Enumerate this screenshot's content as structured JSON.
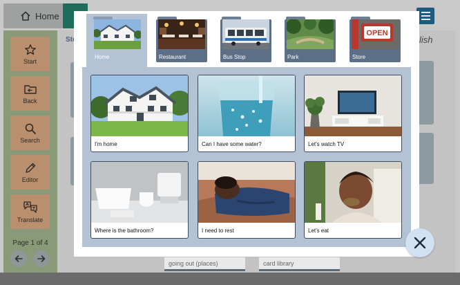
{
  "topbar": {
    "home_label": "Home"
  },
  "sidebar": {
    "items": [
      {
        "label": "Start",
        "icon": "star-icon"
      },
      {
        "label": "Back",
        "icon": "folder-back-icon"
      },
      {
        "label": "Search",
        "icon": "search-icon"
      },
      {
        "label": "Editor",
        "icon": "pencil-icon"
      },
      {
        "label": "Translate",
        "icon": "translate-icon"
      }
    ],
    "page_label": "Page 1 of 4"
  },
  "background": {
    "breadcrumb": "Sto",
    "language_label": "lish",
    "card_labels": [
      "going out (places)",
      "card library"
    ]
  },
  "modal": {
    "folders": [
      {
        "label": "Home",
        "active": true
      },
      {
        "label": "Restaurant",
        "active": false
      },
      {
        "label": "Bus Stop",
        "active": false
      },
      {
        "label": "Park",
        "active": false
      },
      {
        "label": "Store",
        "active": false
      }
    ],
    "store_sign_text": "OPEN",
    "cards": [
      {
        "caption": "I'm home",
        "icon": "house-photo"
      },
      {
        "caption": "Can I have some water?",
        "icon": "water-glass-photo"
      },
      {
        "caption": "Let's watch TV",
        "icon": "tv-photo"
      },
      {
        "caption": "Where is the bathroom?",
        "icon": "bathroom-photo"
      },
      {
        "caption": "I need to rest",
        "icon": "sleeping-person-photo"
      },
      {
        "caption": "Let's eat",
        "icon": "eating-person-photo"
      }
    ]
  },
  "colors": {
    "accent_blue": "#b3c2d5",
    "folder_dark": "#5c6f86",
    "close_button": "#cfe1f2"
  }
}
